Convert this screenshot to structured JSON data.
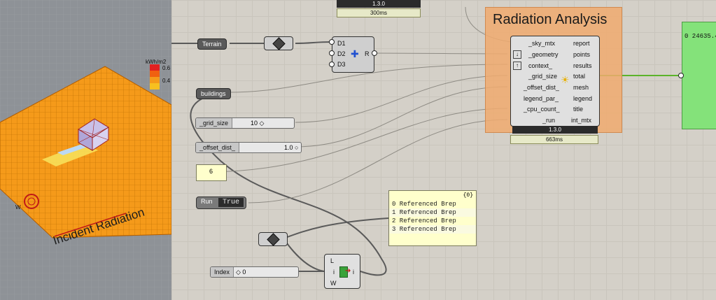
{
  "viewport": {
    "legend_unit": "kWh/m2",
    "legend_values": [
      "0.6",
      "0.4"
    ],
    "title": "Incident Radiation",
    "compass_letter": "W"
  },
  "canvas": {
    "top_component": {
      "version": "1.3.0",
      "time": "300ms"
    },
    "terrain_param": "Terrain",
    "buildings_param": "buildings",
    "merge_component": {
      "inputs": [
        "D1",
        "D2",
        "D3"
      ],
      "output": "R"
    },
    "grid_size_slider": {
      "label": "_grid_size",
      "value": "10 ◇"
    },
    "offset_slider": {
      "label": "_offset_dist_",
      "value": "1.0 ○"
    },
    "cpu_panel_value": "6",
    "run_toggle": {
      "label": "Run",
      "value": "True"
    },
    "radiation_group": {
      "title": "Radiation Analysis",
      "inputs": [
        "_sky_mtx",
        "_geometry",
        "context_",
        "_grid_size",
        "_offset_dist_",
        "legend_par_",
        "_cpu_count_",
        "_run"
      ],
      "outputs": [
        "report",
        "points",
        "results",
        "total",
        "mesh",
        "legend",
        "title",
        "int_mtx"
      ],
      "version": "1.3.0",
      "time": "663ms"
    },
    "brep_panel": {
      "header": "{0}",
      "rows": [
        "0 Referenced Brep",
        "1 Referenced Brep",
        "2 Referenced Brep",
        "3 Referenced Brep"
      ]
    },
    "index_slider": {
      "label": "Index",
      "value": "◇ 0"
    },
    "list_item": {
      "inputs": [
        "L",
        "i",
        "W"
      ],
      "output": "i"
    },
    "total_panel_value": "0 24635.4"
  }
}
